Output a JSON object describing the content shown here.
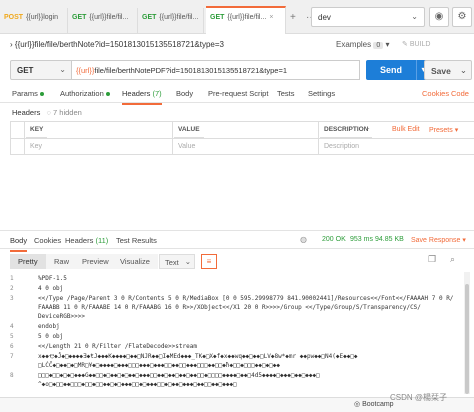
{
  "tabs": [
    {
      "method": "POST",
      "label": "{{url}}login"
    },
    {
      "method": "GET",
      "label": "{{url}}file/fil..."
    },
    {
      "method": "GET",
      "label": "{{url}}file/fil..."
    },
    {
      "method": "GET",
      "label": "{{url}}file/fil..."
    }
  ],
  "tabbar": {
    "new": "+",
    "more": "···",
    "close": "×"
  },
  "environment": {
    "selected": "dev"
  },
  "request_name": "{{url}}file/file/berthNote?id=1501813015135518721&type=3",
  "examples": {
    "label": "Examples",
    "count": "0"
  },
  "build_label": "BUILD",
  "request": {
    "method": "GET",
    "url_var": "{{url}}",
    "url_rest": "file/file/berthNotePDF?id=1501813015135518721&type=1"
  },
  "send": {
    "label": "Send"
  },
  "save": {
    "label": "Save"
  },
  "request_tabs": [
    {
      "label": "Params",
      "dot": true
    },
    {
      "label": "Authorization",
      "dot": true
    },
    {
      "label": "Headers",
      "count": "(7)"
    },
    {
      "label": "Body"
    },
    {
      "label": "Pre-request Script"
    },
    {
      "label": "Tests"
    },
    {
      "label": "Settings"
    }
  ],
  "links": {
    "cookies": "Cookies",
    "code": "Code"
  },
  "headers_section": {
    "title": "Headers",
    "hidden": "7 hidden"
  },
  "headers_table": {
    "columns": [
      "KEY",
      "VALUE",
      "DESCRIPTION"
    ],
    "placeholder_row": [
      "Key",
      "Value",
      "Description"
    ],
    "more": "···",
    "bulk_edit": "Bulk Edit",
    "presets": "Presets"
  },
  "response_tabs": [
    {
      "label": "Body"
    },
    {
      "label": "Cookies"
    },
    {
      "label": "Headers",
      "count": "(11)"
    },
    {
      "label": "Test Results"
    }
  ],
  "response_meta": {
    "status": "200 OK",
    "time": "953 ms",
    "size": "94.85 KB",
    "save": "Save Response"
  },
  "format_bar": {
    "buttons": [
      "Pretty",
      "Raw",
      "Preview",
      "Visualize"
    ],
    "format": "Text"
  },
  "code_lines": [
    {
      "n": "1",
      "t": "%PDF-1.5"
    },
    {
      "n": "2",
      "t": "4 0 obj"
    },
    {
      "n": "3",
      "t": "<</Type /Page/Parent 3 0 R/Contents 5 0 R/MediaBox [0 0 595.29998779 841.90002441]/Resources<</Font<</FAAAAH 7 0 R/"
    },
    {
      "n": "",
      "t": "FAAABB 11 0 R/FAAABE 14 0 R/FAAABG 16 0 R>>/XObject<</X1 20 0 R>>>>/Group <</Type/Group/S/Transparency/CS/"
    },
    {
      "n": "",
      "t": "DeviceRGB>>>>"
    },
    {
      "n": "4",
      "t": "endobj"
    },
    {
      "n": "5",
      "t": "5 0 obj"
    },
    {
      "n": "6",
      "t": "<</Length 21 0 R/Filter /FlateDecode>>stream"
    },
    {
      "n": "7",
      "t": "x◆◆Ҿ◆Ĵ◆□◆◆◆◆Ǝ◆ŧJ◆◆◆K◆◆◆◆□◆◆□NJR◆◆□I◆MEd◆◆◆_TK◆□X◆f◆x◆◆wq◆◆□◆◆□LV◆8w*◆mr  ◆◆pw◆◆□N4(◆E◆◆□◆"
    },
    {
      "n": "",
      "t": "□LĊĈ◆□◆◆□◆□MR□¥◆□◆◆◆◆□◆◆◆□□□◆◆◆□◆◆◆□□◆◆□□◆◆◆□□□◆◆□□◆ħ◆□□◆□□□◆◆□◆□◆◆"
    },
    {
      "n": "8",
      "t": "□□□◆□□◆□◆□◆◆◆G◆◆□□◆□◆◆□◆□◆◆□◆◆◆□□◆◆□◆◆□◆◆□◆◆□□◆□□□□◆◆◆◆□◆◆□4d5◆◆◆◆□◆◆◆□◆◆□◆◆◆□"
    },
    {
      "n": "",
      "t": "^◆o□◆□□◆◆□□□◆□□◆□□◆◆□◆□◆◆◆□□◆□◆◆◆□□◆□◆◆□◆◆◆□◆◆□□◆◆□◆◆◆□"
    }
  ],
  "footer": {
    "bootcamp": "Bootcamp"
  },
  "watermark": "CSDN @楊栞子"
}
